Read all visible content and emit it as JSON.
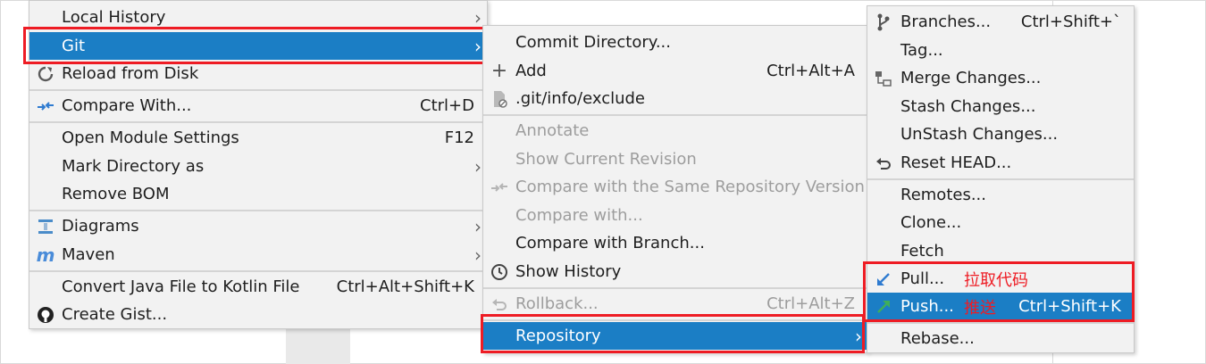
{
  "menu1": {
    "items": [
      {
        "label": "Local History",
        "shortcut": "",
        "submenu": true
      },
      {
        "label": "Git",
        "shortcut": "",
        "submenu": true
      },
      {
        "label": "Reload from Disk",
        "shortcut": ""
      },
      {
        "label": "Compare With...",
        "shortcut": "Ctrl+D"
      },
      {
        "label": "Open Module Settings",
        "shortcut": "F12"
      },
      {
        "label": "Mark Directory as",
        "shortcut": "",
        "submenu": true
      },
      {
        "label": "Remove BOM",
        "shortcut": ""
      },
      {
        "label": "Diagrams",
        "shortcut": "",
        "submenu": true
      },
      {
        "label": "Maven",
        "shortcut": "",
        "submenu": true
      },
      {
        "label": "Convert Java File to Kotlin File",
        "shortcut": "Ctrl+Alt+Shift+K"
      },
      {
        "label": "Create Gist...",
        "shortcut": ""
      }
    ]
  },
  "menu2": {
    "items": [
      {
        "label": "Commit Directory...",
        "shortcut": ""
      },
      {
        "label": "Add",
        "shortcut": "Ctrl+Alt+A"
      },
      {
        "label": ".git/info/exclude",
        "shortcut": ""
      },
      {
        "label": "Annotate",
        "shortcut": "",
        "disabled": true
      },
      {
        "label": "Show Current Revision",
        "shortcut": "",
        "disabled": true
      },
      {
        "label": "Compare with the Same Repository Version",
        "shortcut": "",
        "disabled": true
      },
      {
        "label": "Compare with...",
        "shortcut": "",
        "disabled": true
      },
      {
        "label": "Compare with Branch...",
        "shortcut": ""
      },
      {
        "label": "Show History",
        "shortcut": ""
      },
      {
        "label": "Rollback...",
        "shortcut": "Ctrl+Alt+Z",
        "disabled": true
      },
      {
        "label": "Repository",
        "shortcut": "",
        "submenu": true
      }
    ]
  },
  "menu3": {
    "items": [
      {
        "label": "Branches...",
        "shortcut": "Ctrl+Shift+`"
      },
      {
        "label": "Tag...",
        "shortcut": ""
      },
      {
        "label": "Merge Changes...",
        "shortcut": ""
      },
      {
        "label": "Stash Changes...",
        "shortcut": ""
      },
      {
        "label": "UnStash Changes...",
        "shortcut": ""
      },
      {
        "label": "Reset HEAD...",
        "shortcut": ""
      },
      {
        "label": "Remotes...",
        "shortcut": ""
      },
      {
        "label": "Clone...",
        "shortcut": ""
      },
      {
        "label": "Fetch",
        "shortcut": ""
      },
      {
        "label": "Pull...",
        "shortcut": ""
      },
      {
        "label": "Push...",
        "shortcut": "Ctrl+Shift+K"
      },
      {
        "label": "Rebase...",
        "shortcut": ""
      }
    ]
  },
  "annotations": {
    "pull_note": "拉取代码",
    "push_note": "推送"
  },
  "colors": {
    "selection": "#1b7ec5",
    "highlight_box": "#ee1c24",
    "menu_bg": "#f2f2f2"
  }
}
